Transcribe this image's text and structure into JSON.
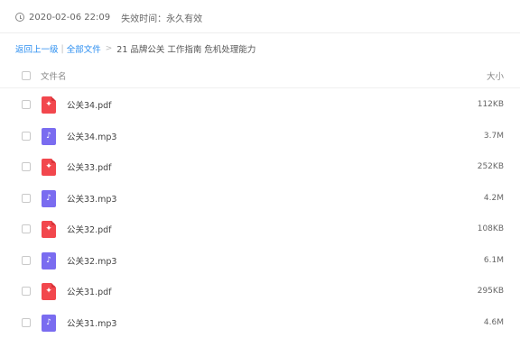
{
  "share_info": {
    "clock_icon": "clock-icon",
    "date": "2020-02-06 22:09",
    "expire_label": "失效时间：永久有效"
  },
  "breadcrumb": {
    "back": "返回上一级",
    "separator": "|",
    "all_files": "全部文件",
    "arrow": ">",
    "current": "21 品牌公关 工作指南 危机处理能力"
  },
  "table": {
    "col_name": "文件名",
    "col_size": "大小",
    "rows": [
      {
        "name": "公关34.pdf",
        "size": "112KB",
        "type": "pdf"
      },
      {
        "name": "公关34.mp3",
        "size": "3.7M",
        "type": "mp3"
      },
      {
        "name": "公关33.pdf",
        "size": "252KB",
        "type": "pdf"
      },
      {
        "name": "公关33.mp3",
        "size": "4.2M",
        "type": "mp3"
      },
      {
        "name": "公关32.pdf",
        "size": "108KB",
        "type": "pdf"
      },
      {
        "name": "公关32.mp3",
        "size": "6.1M",
        "type": "mp3"
      },
      {
        "name": "公关31.pdf",
        "size": "295KB",
        "type": "pdf"
      },
      {
        "name": "公关31.mp3",
        "size": "4.6M",
        "type": "mp3"
      }
    ]
  },
  "colors": {
    "link": "#2b8ef0",
    "pdf": "#f2474d",
    "mp3": "#7a6cf0"
  }
}
